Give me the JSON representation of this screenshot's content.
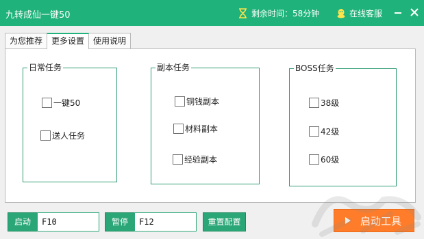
{
  "window": {
    "title": "九转成仙一键50",
    "timer_label": "剩余时间：58分钟",
    "service_label": "在线客服"
  },
  "tabs": [
    {
      "label": "为您推荐",
      "active": false
    },
    {
      "label": "更多设置",
      "active": true
    },
    {
      "label": "使用说明",
      "active": false
    }
  ],
  "groups": {
    "daily": {
      "title": "日常任务",
      "items": [
        {
          "label": "一键50",
          "checked": false
        },
        {
          "label": "送人任务",
          "checked": false
        }
      ]
    },
    "dungeon": {
      "title": "副本任务",
      "items": [
        {
          "label": "铜钱副本",
          "checked": false
        },
        {
          "label": "材料副本",
          "checked": false
        },
        {
          "label": "经验副本",
          "checked": false
        }
      ]
    },
    "boss": {
      "title": "BOSS任务",
      "items": [
        {
          "label": "38级",
          "checked": false
        },
        {
          "label": "42级",
          "checked": false
        },
        {
          "label": "60级",
          "checked": false
        }
      ]
    }
  },
  "footer": {
    "start_label": "启动",
    "start_key": "F10",
    "pause_label": "暂停",
    "pause_key": "F12",
    "reset_label": "重置配置",
    "launch_label": "启动工具"
  },
  "colors": {
    "accent": "#1fb27a",
    "group_border": "#2f9b73",
    "launch": "#ff7d2a"
  }
}
